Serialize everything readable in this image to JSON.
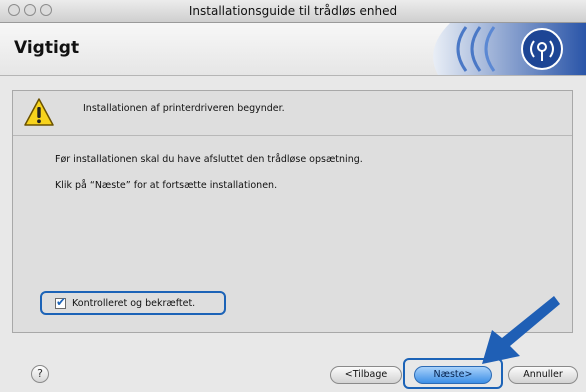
{
  "window": {
    "title": "Installationsguide til trådløs enhed"
  },
  "header": {
    "title": "Vigtigt",
    "brand_icon": "wireless-signal-icon"
  },
  "main": {
    "alert_icon": "warning-icon",
    "alert_text": "Installationen af printerdriveren begynder.",
    "line1": "Før installationen skal du have afsluttet den trådløse opsætning.",
    "line2": "Klik på “Næste” for at fortsætte installationen.",
    "checkbox_label": "Kontrolleret og bekræftet.",
    "checkbox_checked": true
  },
  "footer": {
    "help_label": "?",
    "back_label": "<Tilbage",
    "next_label": "Næste>",
    "cancel_label": "Annuller"
  },
  "colors": {
    "highlight": "#1c63b7",
    "arrow": "#1f5fb5",
    "default_button": "#3d8fe6"
  }
}
